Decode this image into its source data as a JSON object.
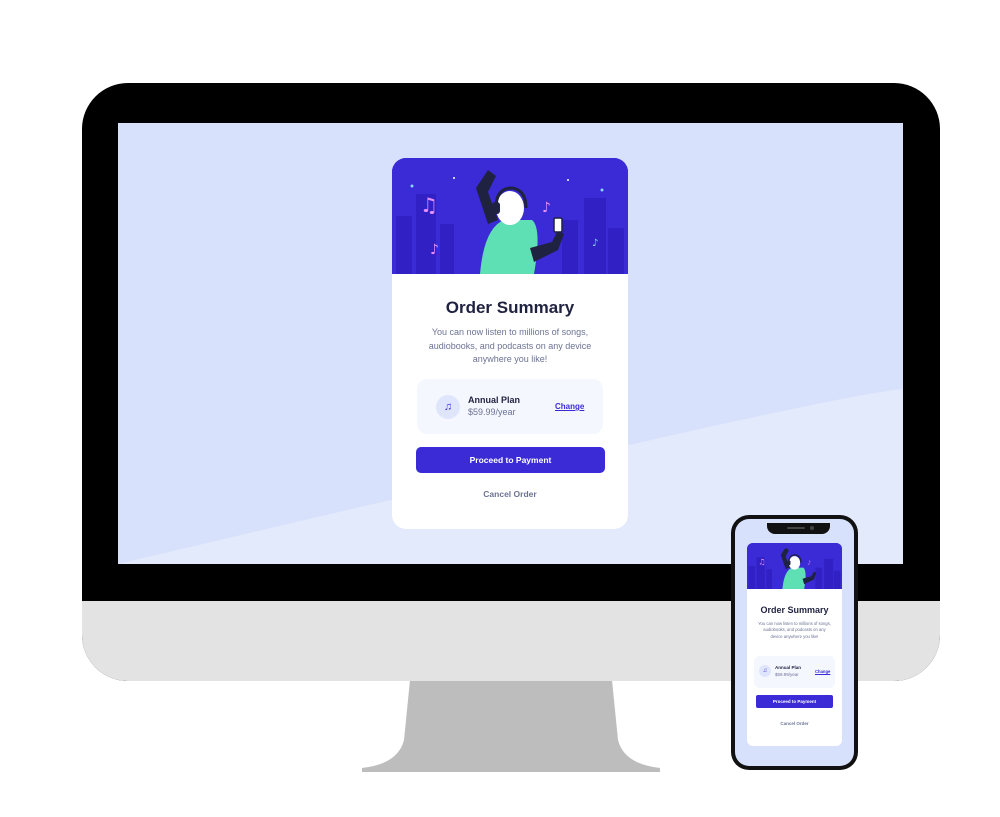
{
  "order_card": {
    "title": "Order Summary",
    "description": "You can now listen to millions of songs, audiobooks, and podcasts on any device anywhere you like!",
    "plan": {
      "name": "Annual Plan",
      "price": "$59.99/year",
      "icon": "music-note-icon",
      "change_label": "Change"
    },
    "pay_button_label": "Proceed to Payment",
    "cancel_label": "Cancel Order"
  },
  "colors": {
    "accent": "#3a2bd6",
    "screen_background": "#d7e1fb",
    "hero_background": "#3a2bd6",
    "title_text": "#1f2240",
    "muted_text": "#6c7394",
    "plan_box": "#f5f7ff"
  }
}
